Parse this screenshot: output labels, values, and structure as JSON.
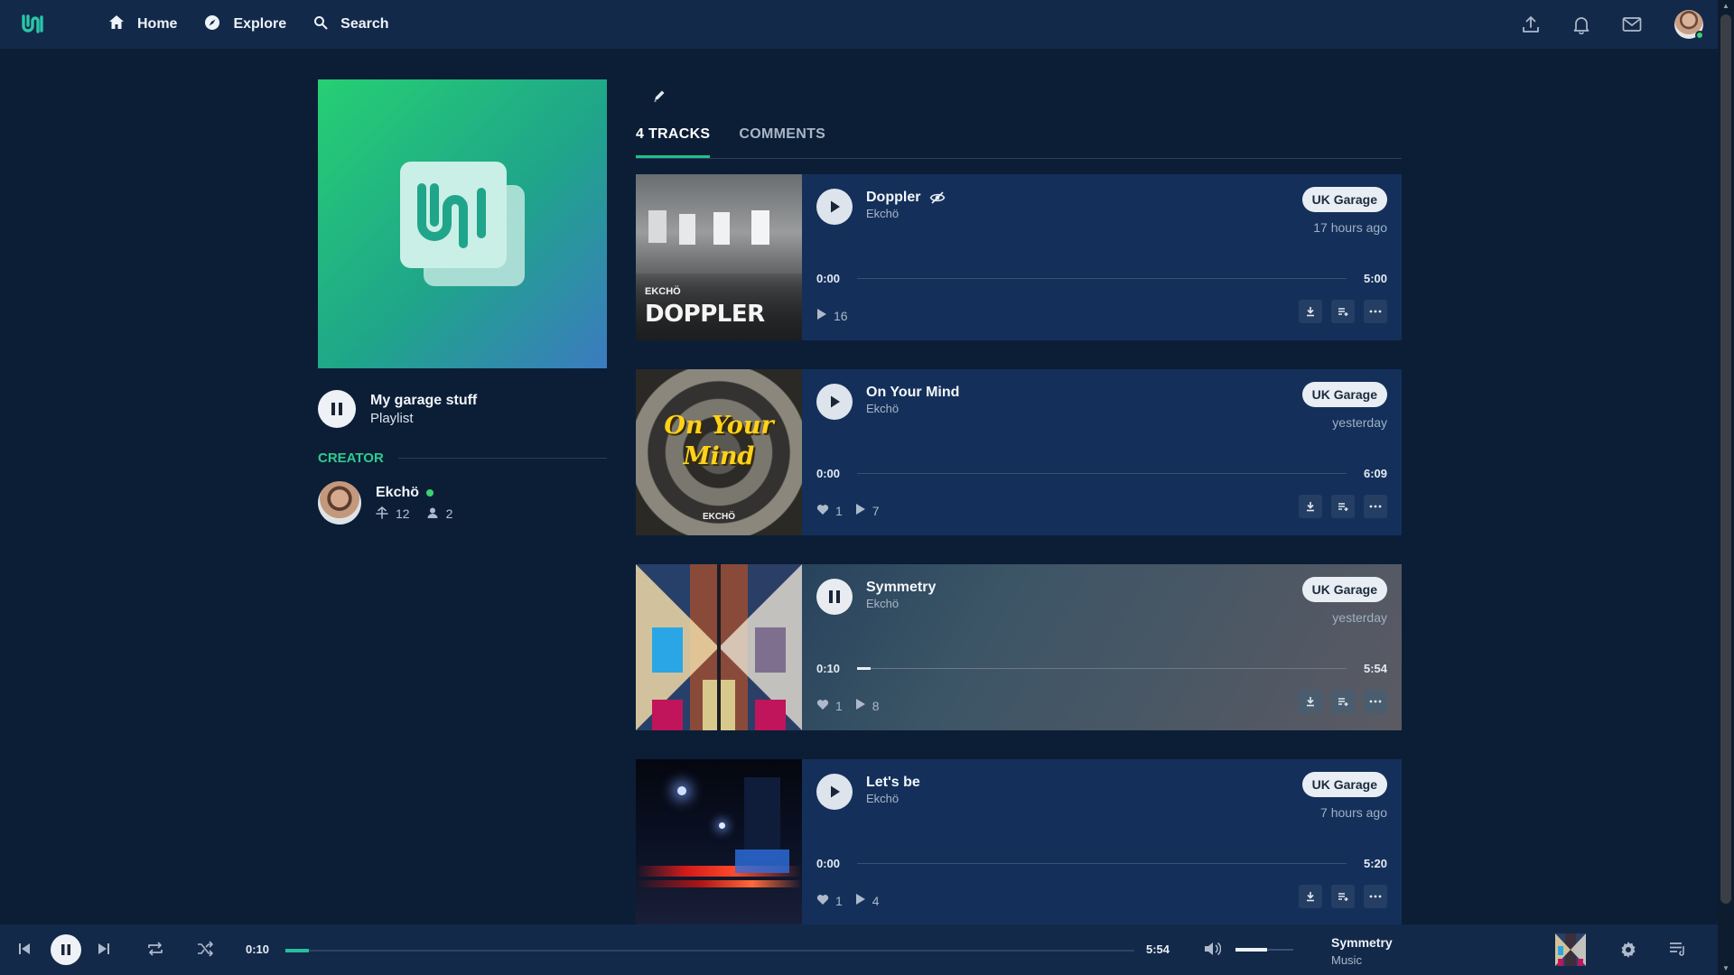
{
  "nav": {
    "home_label": "Home",
    "explore_label": "Explore",
    "search_label": "Search"
  },
  "playlist": {
    "title": "My garage stuff",
    "type": "Playlist"
  },
  "creator": {
    "section_label": "CREATOR",
    "name": "Ekchö",
    "reposts": "12",
    "followers": "2"
  },
  "tabs": {
    "tracks_label": "4 TRACKS",
    "comments_label": "COMMENTS"
  },
  "tracks": [
    {
      "title": "Doppler",
      "artist": "Ekchö",
      "genre": "UK Garage",
      "date": "17 hours ago",
      "current": "0:00",
      "duration": "5:00",
      "progress": 0,
      "plays": "16",
      "hidden": true,
      "art_text_small": "EKCHÖ",
      "art_text_big": "DOPPLER"
    },
    {
      "title": "On Your Mind",
      "artist": "Ekchö",
      "genre": "UK Garage",
      "date": "yesterday",
      "current": "0:00",
      "duration": "6:09",
      "progress": 0,
      "likes": "1",
      "plays": "7",
      "art_text_big": "On Your Mind",
      "art_text_small": "EKCHÖ"
    },
    {
      "title": "Symmetry",
      "artist": "Ekchö",
      "genre": "UK Garage",
      "date": "yesterday",
      "current": "0:10",
      "duration": "5:54",
      "progress": 0.028,
      "likes": "1",
      "plays": "8",
      "playing": true
    },
    {
      "title": "Let's be",
      "artist": "Ekchö",
      "genre": "UK Garage",
      "date": "7 hours ago",
      "current": "0:00",
      "duration": "5:20",
      "progress": 0,
      "likes": "1",
      "plays": "4"
    }
  ],
  "player": {
    "current": "0:10",
    "duration": "5:54",
    "progress": 0.028,
    "volume": 0.55,
    "now_playing_title": "Symmetry",
    "now_playing_sub": "Music"
  },
  "colors": {
    "background": "#0b1e36",
    "topbar": "#13294a",
    "accent": "#23c08a",
    "card": "#14305a"
  }
}
